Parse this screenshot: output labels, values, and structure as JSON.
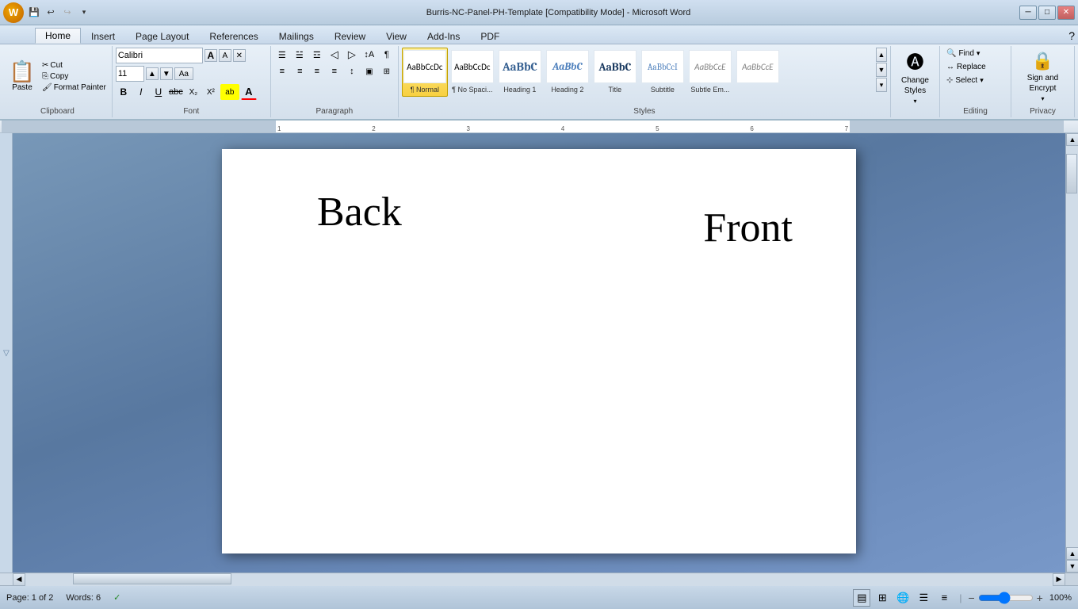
{
  "titlebar": {
    "title": "Burris-NC-Panel-PH-Template [Compatibility Mode] - Microsoft Word",
    "min": "─",
    "max": "□",
    "close": "✕"
  },
  "quickaccess": {
    "save": "💾",
    "undo": "↩",
    "redo": "↪",
    "dropdown": "▾"
  },
  "tabs": [
    {
      "id": "home",
      "label": "Home",
      "active": true
    },
    {
      "id": "insert",
      "label": "Insert",
      "active": false
    },
    {
      "id": "pagelayout",
      "label": "Page Layout",
      "active": false
    },
    {
      "id": "references",
      "label": "References",
      "active": false
    },
    {
      "id": "mailings",
      "label": "Mailings",
      "active": false
    },
    {
      "id": "review",
      "label": "Review",
      "active": false
    },
    {
      "id": "view",
      "label": "View",
      "active": false
    },
    {
      "id": "addins",
      "label": "Add-Ins",
      "active": false
    },
    {
      "id": "pdf",
      "label": "PDF",
      "active": false
    }
  ],
  "clipboard": {
    "paste_label": "Paste",
    "cut_label": "Cut",
    "copy_label": "Copy",
    "format_painter_label": "Format Painter",
    "group_label": "Clipboard"
  },
  "font": {
    "face": "Calibri",
    "size": "11",
    "bold": "B",
    "italic": "I",
    "underline": "U",
    "strikethrough": "ab̶c̶",
    "subscript": "X₂",
    "superscript": "X²",
    "case_btn": "Aa",
    "color_label": "A",
    "highlight": "ab",
    "grow": "A",
    "shrink": "A",
    "clear": "✕",
    "group_label": "Font"
  },
  "paragraph": {
    "bullets": "☰",
    "numbering": "☱",
    "multilevel": "☲",
    "decrease_indent": "◁",
    "increase_indent": "▷",
    "sort": "↕",
    "show_marks": "¶",
    "align_left": "≡",
    "align_center": "≡",
    "align_right": "≡",
    "justify": "≡",
    "line_spacing": "↕",
    "shading": "▣",
    "borders": "□",
    "group_label": "Paragraph"
  },
  "styles": {
    "items": [
      {
        "id": "normal",
        "preview_text": "AaBbCcDc",
        "label": "¶ Normal",
        "active": true
      },
      {
        "id": "no_spacing",
        "preview_text": "AaBbCcDc",
        "label": "¶ No Spaci..."
      },
      {
        "id": "heading1",
        "preview_text": "AaBbC",
        "label": "Heading 1"
      },
      {
        "id": "heading2",
        "preview_text": "AaBbC",
        "label": "Heading 2"
      },
      {
        "id": "title",
        "preview_text": "AaBbC",
        "label": "Title"
      },
      {
        "id": "subtitle",
        "preview_text": "AaBbCcI",
        "label": "Subtitle"
      },
      {
        "id": "subtle_em",
        "preview_text": "AaBbCcE",
        "label": "Subtle Em..."
      },
      {
        "id": "subtle_em2",
        "preview_text": "AaBbCcE",
        "label": ""
      }
    ],
    "group_label": "Styles",
    "scroll_up": "▲",
    "scroll_down": "▼",
    "expand": "▾"
  },
  "change_styles": {
    "label": "Change\nStyles",
    "icon": "🅐"
  },
  "editing": {
    "group_label": "Editing",
    "find_label": "Find",
    "replace_label": "Replace",
    "select_label": "Select"
  },
  "privacy": {
    "group_label": "Privacy",
    "sign_encrypt_label": "Sign and\nEncrypt"
  },
  "document": {
    "text_back": "Back",
    "text_front": "Front"
  },
  "statusbar": {
    "page_info": "Page: 1 of 2",
    "words": "Words: 6",
    "check_icon": "✓",
    "zoom_pct": "100%",
    "zoom_minus": "−",
    "zoom_plus": "+"
  }
}
